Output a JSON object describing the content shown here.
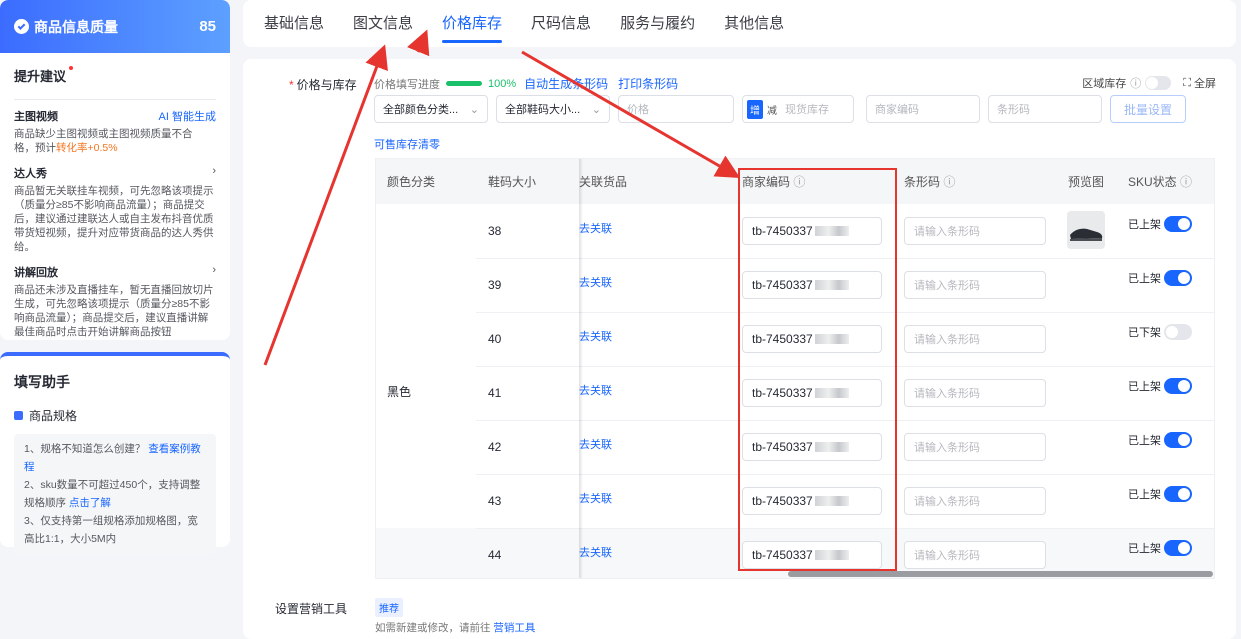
{
  "quality": {
    "title": "商品信息质量",
    "score": "85"
  },
  "suggest": {
    "title": "提升建议",
    "items": [
      {
        "name": "主图视频",
        "action": "AI 智能生成",
        "desc1": "商品缺少主图视频或主图视频质量不合",
        "desc2": "格，预计",
        "hl": "转化率+0.5%"
      },
      {
        "name": "达人秀",
        "desc": "商品暂无关联挂车视频，可先忽略该项提示（质量分≥85不影响商品流量）；商品提交后，建议通过建联达人或自主发布抖音优质带货短视频，提升对应带货商品的达人秀供给。"
      },
      {
        "name": "讲解回放",
        "desc": "商品还未涉及直播挂车，暂无直播回放切片生成，可先忽略该项提示（质量分≥85不影响商品流量）；商品提交后，建议直播讲解最佳商品时点击开始讲解商品按钮"
      }
    ]
  },
  "helper": {
    "title": "填写助手",
    "sub": "商品规格",
    "tip1": "1、规格不知道怎么创建？",
    "tip1_link": "查看案例教程",
    "tip2": "2、sku数量不可超过450个，支持调整规格顺序",
    "tip2_link": "点击了解",
    "tip3": "3、仅支持第一组规格添加规格图，宽高比1:1，大小5M内"
  },
  "tabs": [
    "基础信息",
    "图文信息",
    "价格库存",
    "尺码信息",
    "服务与履约",
    "其他信息"
  ],
  "section": {
    "label": "价格与库存",
    "progress_label": "价格填写进度",
    "progress": "100%",
    "btn_auto": "自动生成条形码",
    "btn_print": "打印条形码",
    "region": "区域库存",
    "fullscreen": "全屏"
  },
  "filters": {
    "color": "全部颜色分类...",
    "size": "全部鞋码大小...",
    "price_ph": "价格",
    "seg_a": "增",
    "seg_b": "减",
    "stock_ph": "现货库存",
    "code_ph": "商家编码",
    "bar_ph": "条形码",
    "batch": "批量设置",
    "clear": "可售库存清零"
  },
  "table": {
    "headers": [
      "颜色分类",
      "鞋码大小",
      "关联货品",
      "商家编码",
      "条形码",
      "预览图",
      "SKU状态"
    ],
    "color": "黑色",
    "relate": "去关联",
    "code_prefix": "tb-7450337",
    "bar_ph": "请输入条形码",
    "rows": [
      {
        "size": "38",
        "status": "已上架",
        "on": true
      },
      {
        "size": "39",
        "status": "已上架",
        "on": true
      },
      {
        "size": "40",
        "status": "已下架",
        "on": false
      },
      {
        "size": "41",
        "status": "已上架",
        "on": true
      },
      {
        "size": "42",
        "status": "已上架",
        "on": true
      },
      {
        "size": "43",
        "status": "已上架",
        "on": true
      },
      {
        "size": "44",
        "status": "已上架",
        "on": true
      }
    ]
  },
  "marketing": {
    "label": "设置营销工具",
    "tag": "推荐",
    "note": "如需新建或修改，请前往",
    "link": "营销工具"
  }
}
